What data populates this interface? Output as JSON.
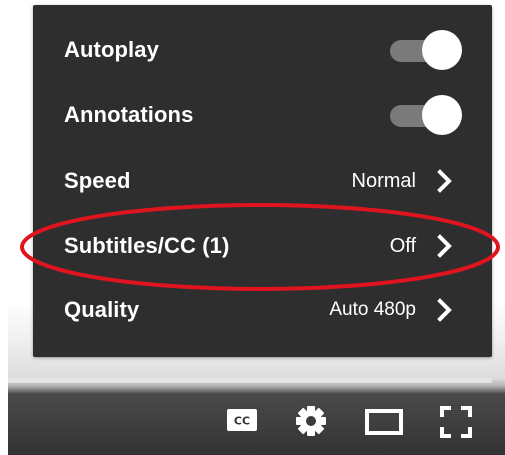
{
  "settings_menu": {
    "rows": [
      {
        "label": "Autoplay",
        "type": "toggle",
        "on": true
      },
      {
        "label": "Annotations",
        "type": "toggle",
        "on": true
      },
      {
        "label": "Speed",
        "type": "submenu",
        "value": "Normal"
      },
      {
        "label": "Subtitles/CC (1)",
        "type": "submenu",
        "value": "Off"
      },
      {
        "label": "Quality",
        "type": "submenu",
        "value": "Auto 480p"
      }
    ]
  },
  "highlight": {
    "target": "Subtitles/CC (1)",
    "color": "#e0141e"
  },
  "colors": {
    "menu_background": "#2e2e2e",
    "toggle_track": "#7a7a7a",
    "toggle_knob": "#ffffff",
    "text": "#ffffff"
  },
  "controls": {
    "icons": [
      "subtitles-cc-icon",
      "settings-gear-icon",
      "theater-mode-icon",
      "fullscreen-icon"
    ]
  }
}
